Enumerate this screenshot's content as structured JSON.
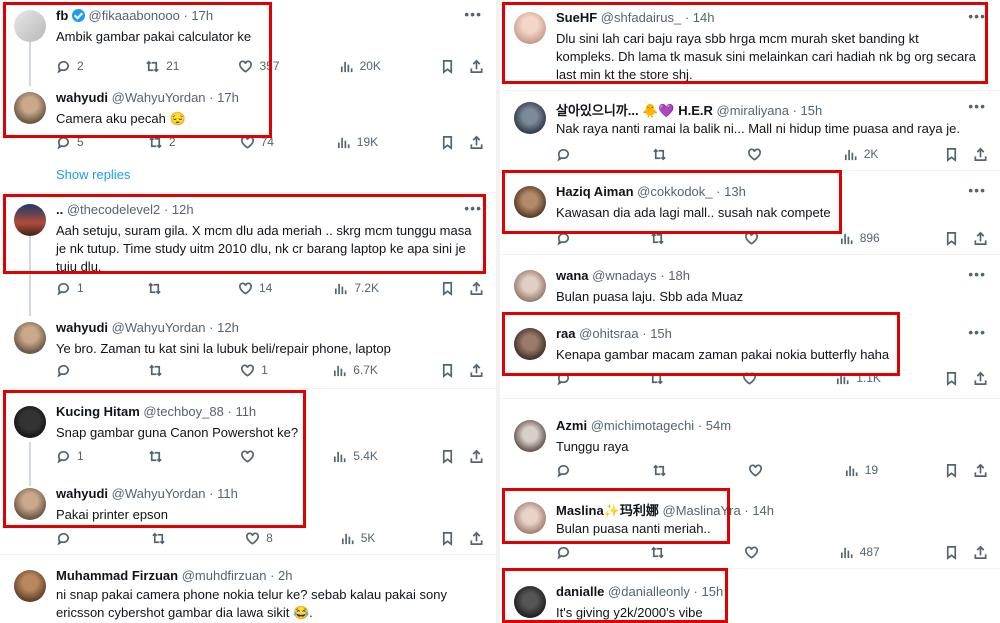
{
  "left": {
    "tweets": [
      {
        "name": "fb",
        "handle": "@fikaaabonooo",
        "time": "17h",
        "text": "Ambik gambar pakai calculator ke",
        "replies": "2",
        "retweets": "21",
        "likes": "357",
        "views": "20K"
      },
      {
        "name": "wahyudi",
        "handle": "@WahyuYordan",
        "time": "17h",
        "text": "Camera aku pecah 😔",
        "replies": "5",
        "retweets": "2",
        "likes": "74",
        "views": "19K"
      },
      {
        "name": "..",
        "handle": "@thecodelevel2",
        "time": "12h",
        "text": "Aah setuju, suram gila. X mcm dlu ada meriah .. skrg mcm tunggu masa je nk tutup. Time study uitm 2010 dlu, nk cr barang laptop ke apa sini je tuju dlu.",
        "replies": "1",
        "retweets": "",
        "likes": "14",
        "views": "7.2K"
      },
      {
        "name": "wahyudi",
        "handle": "@WahyuYordan",
        "time": "12h",
        "text": "Ye bro. Zaman tu kat sini la lubuk beli/repair phone, laptop",
        "replies": "",
        "retweets": "",
        "likes": "1",
        "views": "6.7K"
      },
      {
        "name": "Kucing Hitam",
        "handle": "@techboy_88",
        "time": "11h",
        "text": "Snap gambar guna Canon Powershot ke?",
        "replies": "1",
        "retweets": "",
        "likes": "",
        "views": "5.4K"
      },
      {
        "name": "wahyudi",
        "handle": "@WahyuYordan",
        "time": "11h",
        "text": "Pakai printer epson",
        "replies": "",
        "retweets": "",
        "likes": "8",
        "views": "5K"
      },
      {
        "name": "Muhammad Firzuan",
        "handle": "@muhdfirzuan",
        "time": "2h",
        "text": "ni snap pakai camera phone nokia telur ke? sebab kalau pakai sony ericsson cybershot gambar dia lawa sikit 😂."
      }
    ],
    "show_replies": "Show replies"
  },
  "right": {
    "tweets": [
      {
        "name": "SueHF",
        "handle": "@shfadairus_",
        "time": "14h",
        "text": "Dlu sini lah cari baju raya sbb hrga mcm murah sket banding kt kompleks. Dh lama tk masuk sini melainkan cari hadiah nk bg org secara last min kt the store shj."
      },
      {
        "name": "살아있으니까... 🐥💜 H.E.R",
        "handle": "@miraliyana",
        "time": "15h",
        "text": "Nak raya nanti ramai la balik ni... Mall ni hidup time puasa and raya je.",
        "views": "2K"
      },
      {
        "name": "Haziq Aiman",
        "handle": "@cokkodok_",
        "time": "13h",
        "text": "Kawasan dia ada lagi mall.. susah nak compete",
        "views": "896"
      },
      {
        "name": "wana",
        "handle": "@wnadays",
        "time": "18h",
        "text": "Bulan puasa laju. Sbb ada Muaz"
      },
      {
        "name": "raa",
        "handle": "@ohitsraa",
        "time": "15h",
        "text": "Kenapa gambar macam zaman pakai nokia butterfly haha",
        "views": "1.1K"
      },
      {
        "name": "Azmi",
        "handle": "@michimotagechi",
        "time": "54m",
        "text": "Tunggu raya",
        "views": "19"
      },
      {
        "name": "Maslina✨玛利娜",
        "handle": "@MaslinaYra",
        "time": "14h",
        "text": "Bulan puasa nanti meriah..",
        "views": "487"
      },
      {
        "name": "danialle",
        "handle": "@danialleonly",
        "time": "15h",
        "text": "It's giving y2k/2000's vibe"
      }
    ]
  },
  "icons": {
    "more": "•••"
  },
  "colors": {
    "highlight": "#e00000",
    "link": "#1d9bf0",
    "muted": "#536471"
  }
}
